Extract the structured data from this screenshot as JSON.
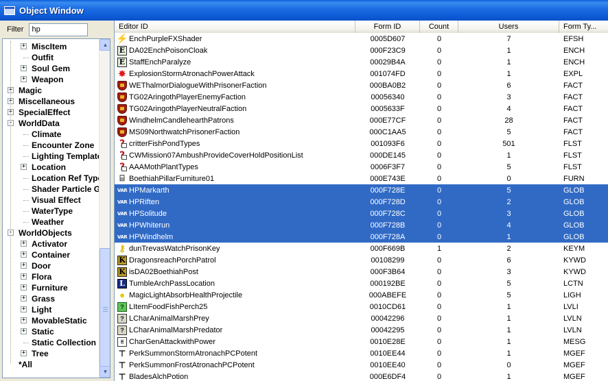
{
  "window": {
    "title": "Object Window"
  },
  "filter": {
    "label": "Filter",
    "value": "hp"
  },
  "tree": {
    "items": [
      {
        "label": "MiscItem",
        "level": 2,
        "expander": "+"
      },
      {
        "label": "Outfit",
        "level": 2,
        "expander": ""
      },
      {
        "label": "Soul Gem",
        "level": 2,
        "expander": "+"
      },
      {
        "label": "Weapon",
        "level": 2,
        "expander": "+"
      },
      {
        "label": "Magic",
        "level": 1,
        "expander": "+"
      },
      {
        "label": "Miscellaneous",
        "level": 1,
        "expander": "+"
      },
      {
        "label": "SpecialEffect",
        "level": 1,
        "expander": "+"
      },
      {
        "label": "WorldData",
        "level": 1,
        "expander": "-"
      },
      {
        "label": "Climate",
        "level": 2,
        "expander": ""
      },
      {
        "label": "Encounter Zone",
        "level": 2,
        "expander": ""
      },
      {
        "label": "Lighting Template",
        "level": 2,
        "expander": ""
      },
      {
        "label": "Location",
        "level": 2,
        "expander": "+"
      },
      {
        "label": "Location Ref Type",
        "level": 2,
        "expander": ""
      },
      {
        "label": "Shader Particle Geometry",
        "level": 2,
        "expander": ""
      },
      {
        "label": "Visual Effect",
        "level": 2,
        "expander": ""
      },
      {
        "label": "WaterType",
        "level": 2,
        "expander": ""
      },
      {
        "label": "Weather",
        "level": 2,
        "expander": ""
      },
      {
        "label": "WorldObjects",
        "level": 1,
        "expander": "-"
      },
      {
        "label": "Activator",
        "level": 2,
        "expander": "+"
      },
      {
        "label": "Container",
        "level": 2,
        "expander": "+"
      },
      {
        "label": "Door",
        "level": 2,
        "expander": "+"
      },
      {
        "label": "Flora",
        "level": 2,
        "expander": "+"
      },
      {
        "label": "Furniture",
        "level": 2,
        "expander": "+"
      },
      {
        "label": "Grass",
        "level": 2,
        "expander": "+"
      },
      {
        "label": "Light",
        "level": 2,
        "expander": "+"
      },
      {
        "label": "MovableStatic",
        "level": 2,
        "expander": "+"
      },
      {
        "label": "Static",
        "level": 2,
        "expander": "+"
      },
      {
        "label": "Static Collection",
        "level": 2,
        "expander": ""
      },
      {
        "label": "Tree",
        "level": 2,
        "expander": "+"
      },
      {
        "label": "*All",
        "level": 1,
        "expander": ""
      }
    ]
  },
  "list": {
    "columns": [
      "Editor ID",
      "Form ID",
      "Count",
      "Users",
      "Form Ty..."
    ],
    "rows": [
      {
        "editor_id": "EnchPurpleFXShader",
        "form_id": "0005D607",
        "count": "0",
        "users": "7",
        "type": "EFSH",
        "icon": "shader-icon",
        "selected": false
      },
      {
        "editor_id": "DA02EnchPoisonCloak",
        "form_id": "000F23C9",
        "count": "0",
        "users": "1",
        "type": "ENCH",
        "icon": "enchantment-icon",
        "selected": false
      },
      {
        "editor_id": "StaffEnchParalyze",
        "form_id": "00029B4A",
        "count": "0",
        "users": "1",
        "type": "ENCH",
        "icon": "enchantment-icon",
        "selected": false
      },
      {
        "editor_id": "ExplosionStormAtronachPowerAttack",
        "form_id": "001074FD",
        "count": "0",
        "users": "1",
        "type": "EXPL",
        "icon": "explosion-icon",
        "selected": false
      },
      {
        "editor_id": "WEThalmorDialogueWithPrisonerFaction",
        "form_id": "000BA0B2",
        "count": "0",
        "users": "6",
        "type": "FACT",
        "icon": "faction-shield-icon",
        "selected": false
      },
      {
        "editor_id": "TG02AringothPlayerEnemyFaction",
        "form_id": "00056340",
        "count": "0",
        "users": "3",
        "type": "FACT",
        "icon": "faction-shield-icon",
        "selected": false
      },
      {
        "editor_id": "TG02AringothPlayerNeutralFaction",
        "form_id": "0005633F",
        "count": "0",
        "users": "4",
        "type": "FACT",
        "icon": "faction-shield-icon",
        "selected": false
      },
      {
        "editor_id": "WindhelmCandlehearthPatrons",
        "form_id": "000E77CF",
        "count": "0",
        "users": "28",
        "type": "FACT",
        "icon": "faction-shield-icon",
        "selected": false
      },
      {
        "editor_id": "MS09NorthwatchPrisonerFaction",
        "form_id": "000C1AA5",
        "count": "0",
        "users": "5",
        "type": "FACT",
        "icon": "faction-shield-icon",
        "selected": false
      },
      {
        "editor_id": "critterFishPondTypes",
        "form_id": "001093F6",
        "count": "0",
        "users": "501",
        "type": "FLST",
        "icon": "formlist-icon",
        "selected": false
      },
      {
        "editor_id": "CWMission07AmbushProvideCoverHoldPositionList",
        "form_id": "000DE145",
        "count": "0",
        "users": "1",
        "type": "FLST",
        "icon": "formlist-icon",
        "selected": false
      },
      {
        "editor_id": "AAAMothPlantTypes",
        "form_id": "0006F3F7",
        "count": "0",
        "users": "5",
        "type": "FLST",
        "icon": "formlist-icon",
        "selected": false
      },
      {
        "editor_id": "BoethiahPillarFurniture01",
        "form_id": "000E743E",
        "count": "0",
        "users": "0",
        "type": "FURN",
        "icon": "furniture-icon",
        "selected": false
      },
      {
        "editor_id": "HPMarkarth",
        "form_id": "000F728E",
        "count": "0",
        "users": "5",
        "type": "GLOB",
        "icon": "variable-icon",
        "selected": true
      },
      {
        "editor_id": "HPRiften",
        "form_id": "000F728D",
        "count": "0",
        "users": "2",
        "type": "GLOB",
        "icon": "variable-icon",
        "selected": true
      },
      {
        "editor_id": "HPSolitude",
        "form_id": "000F728C",
        "count": "0",
        "users": "3",
        "type": "GLOB",
        "icon": "variable-icon",
        "selected": true
      },
      {
        "editor_id": "HPWhiterun",
        "form_id": "000F728B",
        "count": "0",
        "users": "4",
        "type": "GLOB",
        "icon": "variable-icon",
        "selected": true
      },
      {
        "editor_id": "HPWindhelm",
        "form_id": "000F728A",
        "count": "0",
        "users": "1",
        "type": "GLOB",
        "icon": "variable-icon",
        "selected": true
      },
      {
        "editor_id": "dunTrevasWatchPrisonKey",
        "form_id": "000F669B",
        "count": "1",
        "users": "2",
        "type": "KEYM",
        "icon": "key-icon",
        "selected": false
      },
      {
        "editor_id": "DragonsreachPorchPatrol",
        "form_id": "00108299",
        "count": "0",
        "users": "6",
        "type": "KYWD",
        "icon": "keyword-icon",
        "selected": false
      },
      {
        "editor_id": "isDA02BoethiahPost",
        "form_id": "000F3B64",
        "count": "0",
        "users": "3",
        "type": "KYWD",
        "icon": "keyword-icon",
        "selected": false
      },
      {
        "editor_id": "TumbleArchPassLocation",
        "form_id": "000192BE",
        "count": "0",
        "users": "5",
        "type": "LCTN",
        "icon": "location-icon",
        "selected": false
      },
      {
        "editor_id": "MagicLightAbsorbHealthProjectile",
        "form_id": "000ABEFE",
        "count": "0",
        "users": "5",
        "type": "LIGH",
        "icon": "lightbulb-icon",
        "selected": false
      },
      {
        "editor_id": "LItemFoodFishPerch25",
        "form_id": "0010CD61",
        "count": "0",
        "users": "1",
        "type": "LVLI",
        "icon": "leveled-item-icon",
        "selected": false
      },
      {
        "editor_id": "LCharAnimalMarshPrey",
        "form_id": "00042296",
        "count": "0",
        "users": "1",
        "type": "LVLN",
        "icon": "leveled-npc-icon",
        "selected": false
      },
      {
        "editor_id": "LCharAnimalMarshPredator",
        "form_id": "00042295",
        "count": "0",
        "users": "1",
        "type": "LVLN",
        "icon": "leveled-npc-icon",
        "selected": false
      },
      {
        "editor_id": "CharGenAttackwithPower",
        "form_id": "0010E28E",
        "count": "0",
        "users": "1",
        "type": "MESG",
        "icon": "message-icon",
        "selected": false
      },
      {
        "editor_id": "PerkSummonStormAtronachPCPotent",
        "form_id": "0010EE44",
        "count": "0",
        "users": "1",
        "type": "MGEF",
        "icon": "magic-effect-icon",
        "selected": false
      },
      {
        "editor_id": "PerkSummonFrostAtronachPCPotent",
        "form_id": "0010EE40",
        "count": "0",
        "users": "0",
        "type": "MGEF",
        "icon": "magic-effect-icon",
        "selected": false
      },
      {
        "editor_id": "BladesAlchPotion",
        "form_id": "000E6DF4",
        "count": "0",
        "users": "1",
        "type": "MGEF",
        "icon": "magic-effect-icon",
        "selected": false
      }
    ]
  }
}
